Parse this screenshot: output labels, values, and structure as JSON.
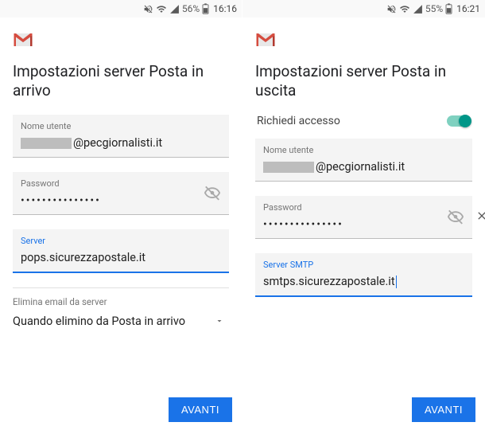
{
  "colors": {
    "accent": "#1a73e8",
    "switch": "#009688"
  },
  "left": {
    "status": {
      "battery": "56%",
      "time": "16:16"
    },
    "title": "Impostazioni server Posta in arrivo",
    "username": {
      "label": "Nome utente",
      "domain": "@pecgiornalisti.it"
    },
    "password": {
      "label": "Password",
      "masked": "•••••••••••••••"
    },
    "server": {
      "label": "Server",
      "value": "pops.sicurezzapostale.it"
    },
    "delete_section": {
      "label": "Elimina email da server",
      "value": "Quando elimino da Posta in arrivo"
    },
    "next_button": "AVANTI"
  },
  "right": {
    "status": {
      "battery": "55%",
      "time": "16:21"
    },
    "title": "Impostazioni server Posta in uscita",
    "require_signin": {
      "label": "Richiedi accesso",
      "on": true
    },
    "username": {
      "label": "Nome utente",
      "domain": "@pecgiornalisti.it"
    },
    "password": {
      "label": "Password",
      "masked": "•••••••••••••••"
    },
    "server": {
      "label": "Server SMTP",
      "value": "smtps.sicurezzapostale.it"
    },
    "next_button": "AVANTI"
  },
  "icons": {
    "mute": "mute-icon",
    "wifi": "wifi-icon",
    "signal": "signal-icon",
    "battery": "battery-icon",
    "gmail": "gmail-logo",
    "eye_off": "visibility-off-icon",
    "dropdown": "dropdown-icon",
    "clear": "clear-icon"
  }
}
